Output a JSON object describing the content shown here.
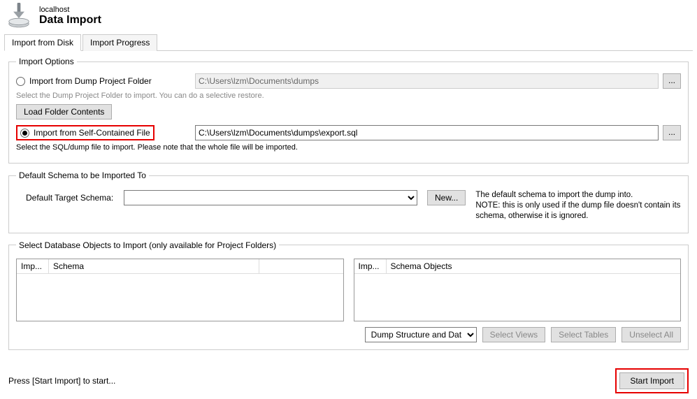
{
  "header": {
    "host": "localhost",
    "title": "Data Import"
  },
  "tabs": {
    "disk": "Import from Disk",
    "progress": "Import Progress"
  },
  "options": {
    "legend": "Import Options",
    "folder_radio": "Import from Dump Project Folder",
    "folder_path": "C:\\Users\\lzm\\Documents\\dumps",
    "browse": "...",
    "folder_hint": "Select the Dump Project Folder to import. You can do a selective restore.",
    "load_folder": "Load Folder Contents",
    "file_radio": "Import from Self-Contained File",
    "file_path": "C:\\Users\\lzm\\Documents\\dumps\\export.sql",
    "file_hint": "Select the SQL/dump file to import. Please note that the whole file will be imported."
  },
  "schema": {
    "legend": "Default Schema to be Imported To",
    "label": "Default Target Schema:",
    "value": "",
    "new": "New...",
    "note": "The default schema to import the dump into.\nNOTE: this is only used if the dump file doesn't contain its schema, otherwise it is ignored."
  },
  "objects": {
    "legend": "Select Database Objects to Import (only available for Project Folders)",
    "col_imp": "Imp...",
    "col_schema": "Schema",
    "col_objects": "Schema Objects",
    "dump_select": "Dump Structure and Dat",
    "select_views": "Select Views",
    "select_tables": "Select Tables",
    "unselect_all": "Unselect All"
  },
  "footer": {
    "status": "Press [Start Import] to start...",
    "start": "Start Import"
  }
}
